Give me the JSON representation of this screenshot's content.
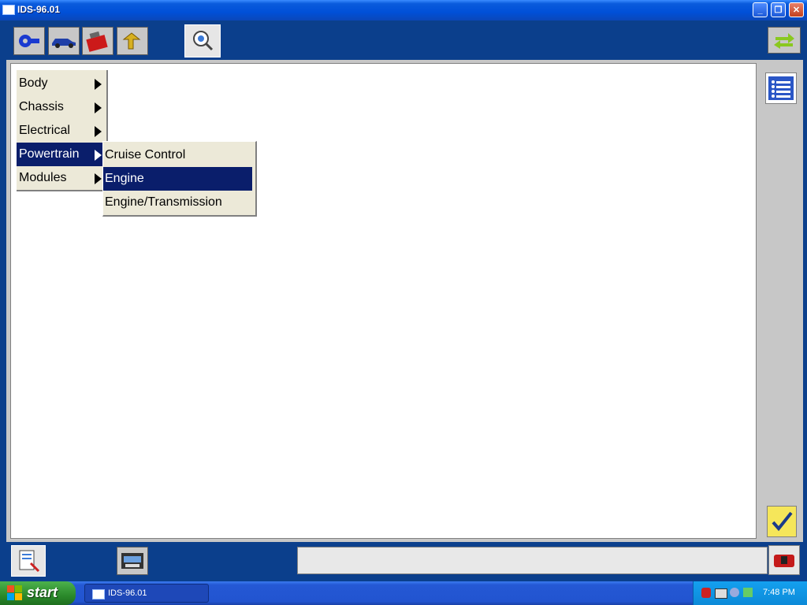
{
  "window": {
    "title": "IDS-96.01"
  },
  "menus": {
    "level1": [
      {
        "label": "Body",
        "has_submenu": true,
        "selected": false
      },
      {
        "label": "Chassis",
        "has_submenu": true,
        "selected": false
      },
      {
        "label": "Electrical",
        "has_submenu": true,
        "selected": false
      },
      {
        "label": "Powertrain",
        "has_submenu": true,
        "selected": true
      },
      {
        "label": "Modules",
        "has_submenu": true,
        "selected": false
      }
    ],
    "level2": [
      {
        "label": "Cruise Control",
        "selected": false
      },
      {
        "label": "Engine",
        "selected": true
      },
      {
        "label": "Engine/Transmission",
        "selected": false
      }
    ]
  },
  "toolbar": {
    "icons": [
      "vehicle-connect-icon",
      "vehicle-icon",
      "toolbox-icon",
      "tasks-icon",
      "test-magnifier-icon",
      "swap-arrows-icon",
      "list-icon",
      "checkmark-icon"
    ]
  },
  "taskbar": {
    "start_label": "start",
    "task_label": "IDS-96.01",
    "clock": "7:48 PM"
  },
  "colors": {
    "selection": "#0a1e6b",
    "app_background": "#0b3f8c",
    "menu_background": "#ece9d8"
  }
}
